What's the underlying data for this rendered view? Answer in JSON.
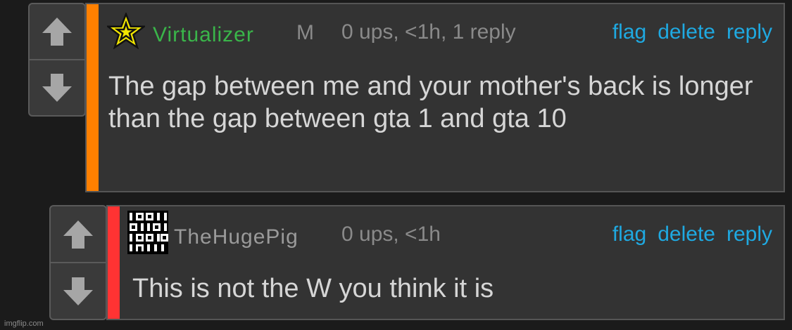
{
  "comments": [
    {
      "username": "Virtualizer",
      "user_badge": "M",
      "meta": "0 ups, <1h, 1 reply",
      "actions": {
        "flag": "flag",
        "delete": "delete",
        "reply": "reply"
      },
      "text": "The gap between me and your mother's back is longer than the gap between gta 1 and gta 10",
      "stripe_color": "#ff8000",
      "username_color": "#3ab54a",
      "avatar_icon": "star-icon"
    },
    {
      "username": "TheHugePig",
      "meta": "0 ups, <1h",
      "actions": {
        "flag": "flag",
        "delete": "delete",
        "reply": "reply"
      },
      "text": "This is not the W you think it is",
      "stripe_color": "#ff3333",
      "username_color": "#9a9a9a",
      "avatar_icon": "binary-icon"
    }
  ],
  "watermark": "imgflip.com",
  "colors": {
    "link": "#1fa9e1",
    "background": "#1b1b1b",
    "panel": "#333333"
  }
}
